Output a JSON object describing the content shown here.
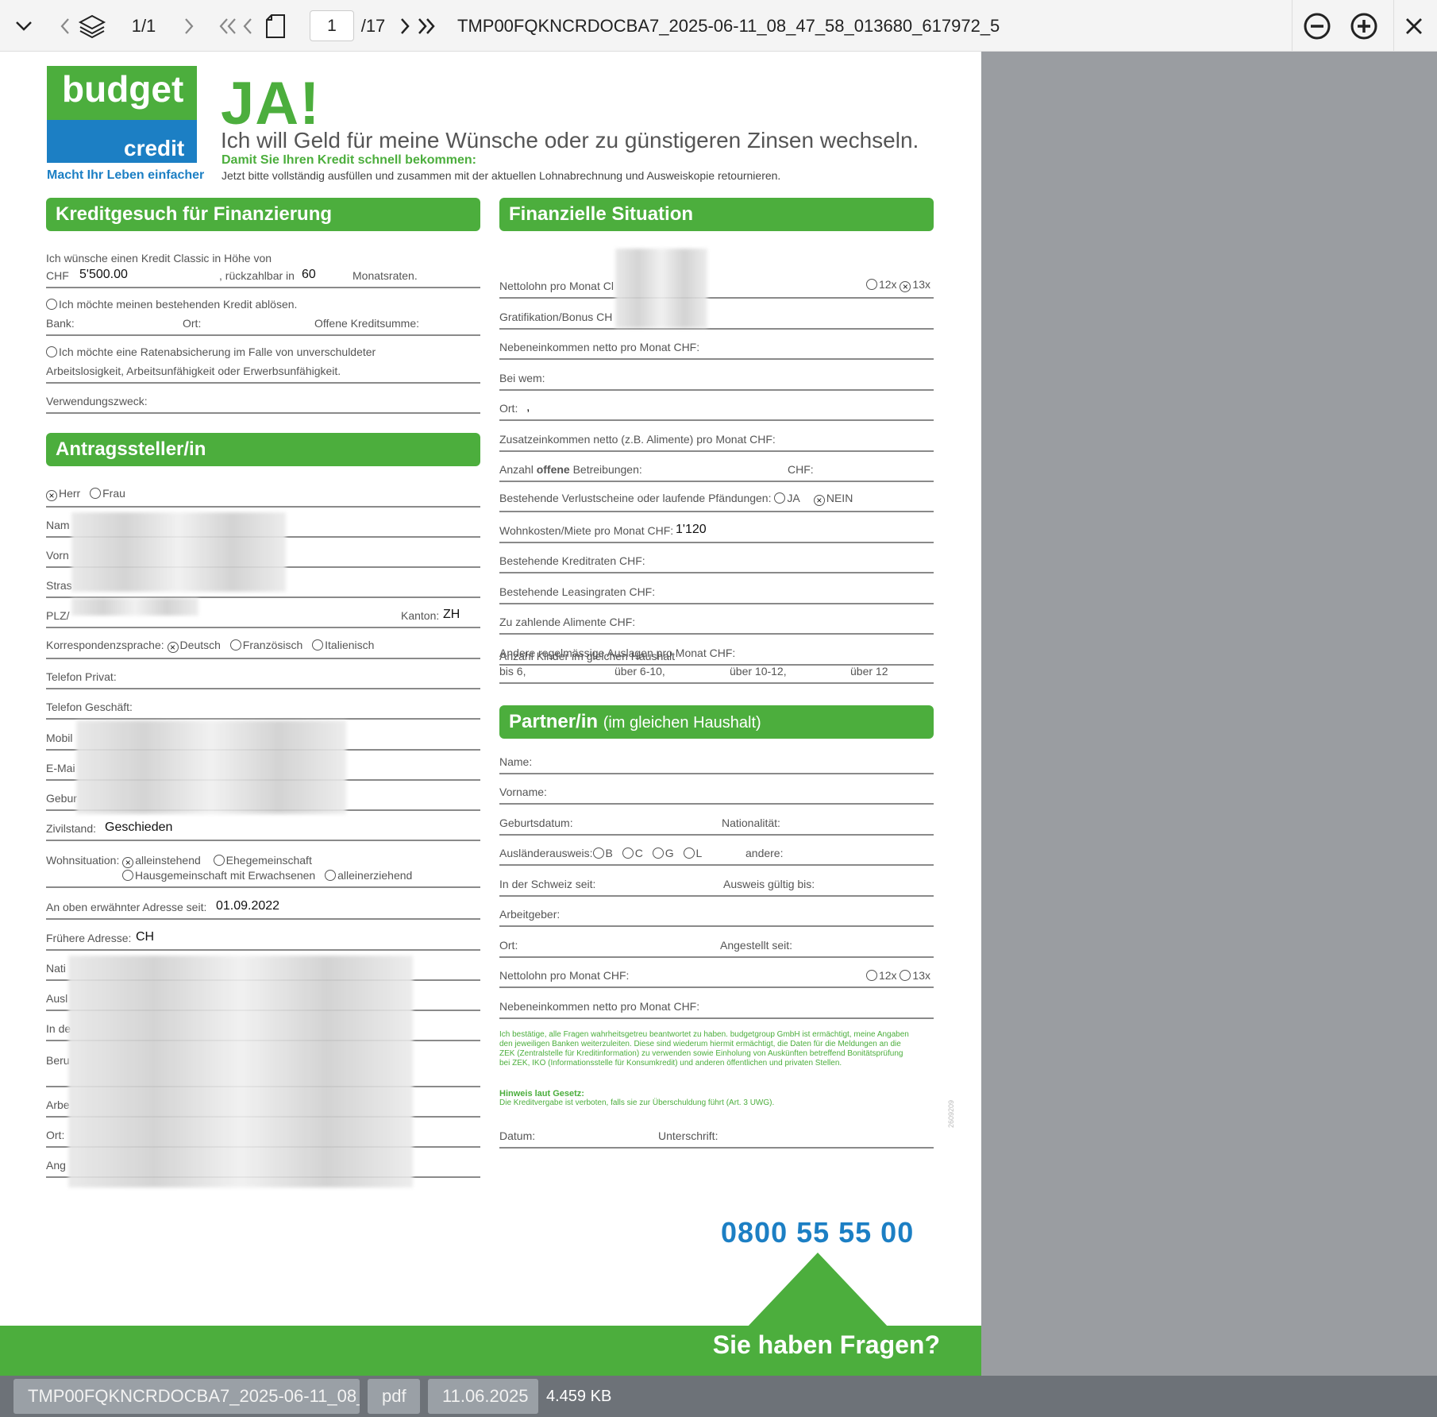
{
  "toolbar": {
    "page_counter": "1/1",
    "page_number": "1",
    "page_total": "/17",
    "document_title": "TMP00FQKNCRDOCBA7_2025-06-11_08_47_58_013680_617972_5"
  },
  "statusbar": {
    "filename": "TMP00FQKNCRDOCBA7_2025-06-11_08_...",
    "filetype": "pdf",
    "date": "11.06.2025",
    "size": "4.459 KB"
  },
  "form": {
    "logo_word1": "budget",
    "logo_word2": "credit",
    "tagline": "Macht Ihr Leben einfacher",
    "ja": "JA!",
    "headline": "Ich will Geld für meine Wünsche oder zu günstigeren Zinsen wechseln.",
    "subheadline": "Damit Sie Ihren Kredit schnell bekommen:",
    "instructions": "Jetzt bitte vollständig ausfüllen und zusammen mit der aktuellen Lohnabrechnung und Ausweiskopie retournieren.",
    "sec_kredit": "Kreditgesuch für Finanzierung",
    "sec_fin": "Finanzielle Situation",
    "sec_antrag": "Antragssteller/in",
    "sec_partner": "Partner/in",
    "sec_partner_sub": "(im gleichen Haushalt)",
    "left": {
      "kredit_l1": "Ich wünsche einen Kredit Classic in Höhe von",
      "chf": "CHF",
      "amount": "5'500.00",
      "rueck": ", rückzahlbar in",
      "months": "60",
      "monatsraten": "Monatsraten.",
      "abloesen": "Ich möchte meinen bestehenden Kredit ablösen.",
      "bank": "Bank:",
      "ort": "Ort:",
      "offene": "Offene Kreditsumme:",
      "rate1": "Ich möchte eine Ratenabsicherung im Falle von unverschuldeter",
      "rate2": "Arbeitslosigkeit, Arbeitsunfähigkeit oder Erwerbsunfähigkeit.",
      "zweck": "Verwendungszweck:",
      "herr": "Herr",
      "frau": "Frau",
      "name": "Nam",
      "vorname": "Vorn",
      "strasse": "Stras",
      "plz": "PLZ/",
      "kanton": "Kanton:",
      "kanton_val": "ZH",
      "korr": "Korrespondenzsprache:",
      "deutsch": "Deutsch",
      "franz": "Französisch",
      "ital": "Italienisch",
      "tel_privat": "Telefon Privat:",
      "tel_geschaeft": "Telefon Geschäft:",
      "mobil": "Mobil",
      "email": "E-Mai",
      "geburt": "Gebur",
      "zivil": "Zivilstand:",
      "zivil_val": "Geschieden",
      "wohn": "Wohnsituation:",
      "allein": "alleinstehend",
      "ehe": "Ehegemeinschaft",
      "haus": "Hausgemeinschaft mit Erwachsenen",
      "alleinerz": "alleinerziehend",
      "adresse_seit": "An oben erwähnter Adresse seit:",
      "adresse_seit_val": "01.09.2022",
      "frueher": "Frühere Adresse:",
      "frueher_val": "CH",
      "nati": "Nati",
      "ausl": "Ausl",
      "inde": "In de",
      "beru": "Beru",
      "arbe": "Arbe",
      "ort2": "Ort:",
      "ang": "Ang"
    },
    "right": {
      "netto": "Nettolohn pro Monat Cl",
      "x12": "12x",
      "x13": "13x",
      "grat": "Gratifikation/Bonus CH",
      "neben": "Nebeneinkommen netto pro Monat CHF:",
      "beiwem": "Bei wem:",
      "ort": "Ort:",
      "ort_val": ",",
      "zusatz": "Zusatzeinkommen netto (z.B. Alimente) pro Monat CHF:",
      "betr_a": "Anzahl",
      "betr_b": "offene",
      "betr_c": "Betreibungen:",
      "betr_chf": "CHF:",
      "verlust": "Bestehende Verlustscheine oder laufende Pfändungen:",
      "ja": "JA",
      "nein": "NEIN",
      "wohnkosten": "Wohnkosten/Miete pro Monat CHF:",
      "wohnkosten_val": "1'120",
      "kreditraten": "Bestehende Kreditraten CHF:",
      "leasing": "Bestehende Leasingraten CHF:",
      "alimente": "Zu zahlende Alimente CHF:",
      "andere": "Andere regelmässige Auslagen pro Monat CHF:",
      "kinder": "Anzahl Kinder im gleichen Haushalt",
      "bis6": "bis 6,",
      "u610": "über 6-10,",
      "u1012": "über 10-12,",
      "u12": "über 12"
    },
    "partner": {
      "name": "Name:",
      "vorname": "Vorname:",
      "geburt": "Geburtsdatum:",
      "nation": "Nationalität:",
      "auslaender": "Ausländerausweis:",
      "b": "B",
      "c": "C",
      "g": "G",
      "l": "L",
      "andere": "andere:",
      "schweiz": "In der Schweiz seit:",
      "gueltig": "Ausweis gültig bis:",
      "arbeitgeber": "Arbeitgeber:",
      "ort": "Ort:",
      "angestellt": "Angestellt seit:",
      "netto": "Nettolohn pro Monat CHF:",
      "x12": "12x",
      "x13": "13x",
      "neben": "Nebeneinkommen netto pro Monat CHF:",
      "note": "Ich bestätige, alle Fragen wahrheitsgetreu beantwortet zu haben. budgetgroup GmbH ist ermächtigt, meine Angaben den jeweiligen Banken weiterzuleiten. Diese sind wiederum hiermit ermächtigt, die Daten für die Meldungen an die ZEK (Zentralstelle für Kreditinformation) zu verwenden sowie Einholung von Auskünften betreffend Bonitätsprüfung bei ZEK, IKO (Informationsstelle für Konsumkredit) und anderen öffentlichen und privaten Stellen.",
      "hinweis": "Hinweis laut Gesetz:",
      "hinweis_text": "Die Kreditvergabe ist verboten, falls sie zur Überschuldung führt (Art. 3 UWG).",
      "datum": "Datum:",
      "unterschrift": "Unterschrift:"
    },
    "phone": "0800 55 55 00",
    "fragen": "Sie haben Fragen?",
    "vcode": "2609209"
  },
  "colors": {
    "green": "#4cae3d",
    "blue": "#1c7fc4",
    "viewer_bg": "#9a9da1",
    "statusbar": "#6d7278"
  },
  "icons": [
    "chevron-down-icon",
    "chevron-left-icon",
    "layers-icon",
    "chevron-right-icon",
    "first-page-icon",
    "prev-page-icon",
    "document-icon",
    "next-page-icon",
    "last-page-icon",
    "zoom-out-icon",
    "zoom-in-icon",
    "close-icon"
  ]
}
